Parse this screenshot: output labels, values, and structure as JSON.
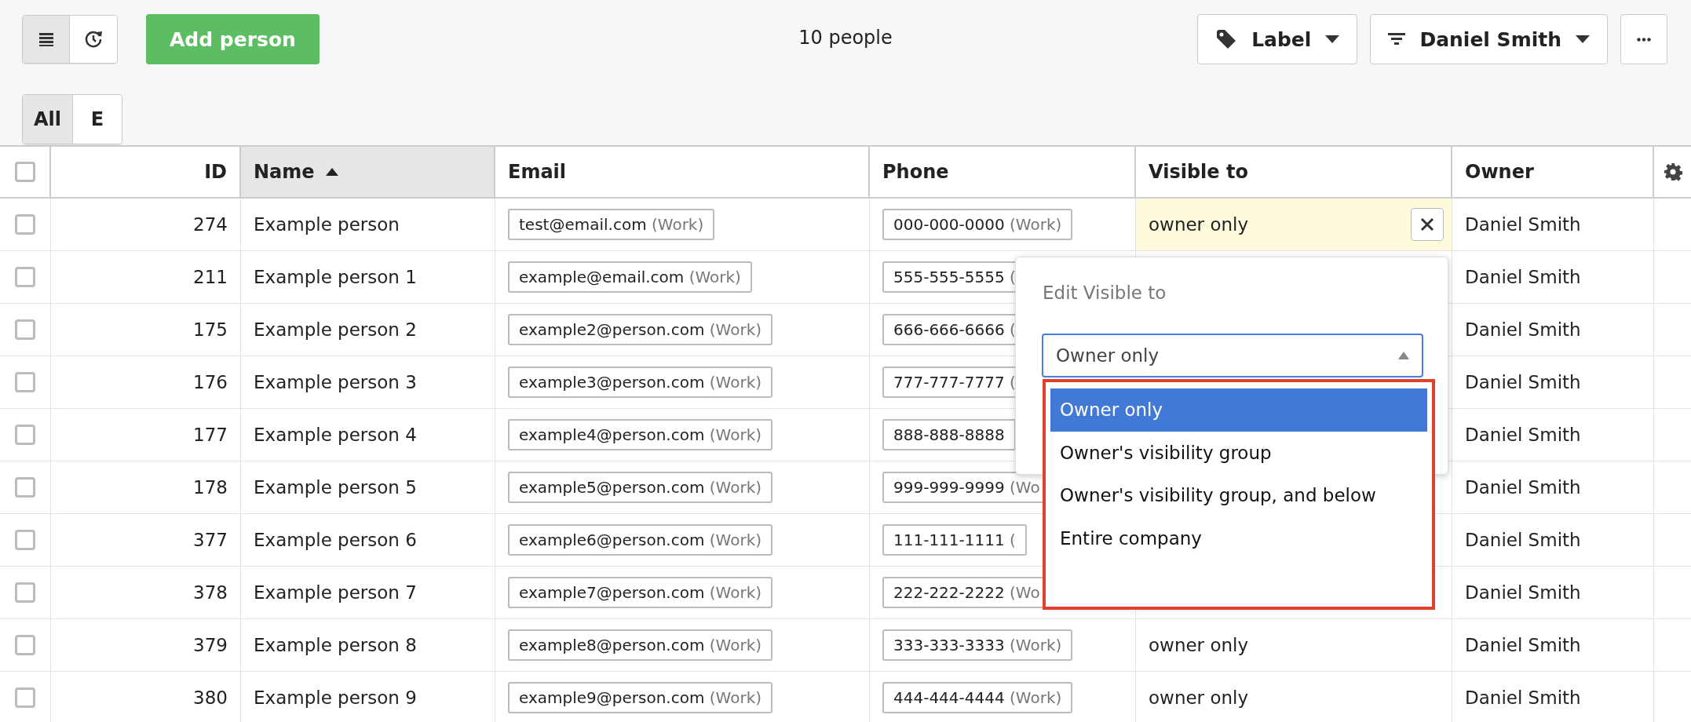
{
  "toolbar": {
    "view_toggle": [
      {
        "kind": "list",
        "selected": true
      },
      {
        "kind": "timeline",
        "selected": false
      }
    ],
    "add_button": "Add person",
    "count": "10 people",
    "label_button": "Label",
    "filter_button": "Daniel Smith",
    "segments": [
      {
        "label": "All",
        "selected": true
      },
      {
        "label": "E",
        "selected": false
      }
    ]
  },
  "table": {
    "select_all_checked": false,
    "columns": [
      {
        "label": "ID",
        "sorted": false
      },
      {
        "label": "Name",
        "sorted": true
      },
      {
        "label": "Email",
        "sorted": false
      },
      {
        "label": "Phone",
        "sorted": false
      },
      {
        "label": "Visible to",
        "sorted": false
      },
      {
        "label": "Owner",
        "sorted": false
      }
    ],
    "rows": [
      {
        "checked": false,
        "id": "274",
        "name": "Example person",
        "email": "test@email.com",
        "email_type": "(Work)",
        "phone": "000-000-0000",
        "phone_type": "(Work)",
        "visible_to": "owner only",
        "editing": true,
        "owner": "Daniel Smith"
      },
      {
        "checked": false,
        "id": "211",
        "name": "Example person 1",
        "email": "example@email.com",
        "email_type": "(Work)",
        "phone": "555-555-5555",
        "phone_type": "(",
        "editing": false,
        "owner": "Daniel Smith"
      },
      {
        "checked": false,
        "id": "175",
        "name": "Example person 2",
        "email": "example2@person.com",
        "email_type": "(Work)",
        "phone": "666-666-6666",
        "phone_type": "(",
        "editing": false,
        "owner": "Daniel Smith"
      },
      {
        "checked": false,
        "id": "176",
        "name": "Example person 3",
        "email": "example3@person.com",
        "email_type": "(Work)",
        "phone": "777-777-7777",
        "phone_type": "(",
        "editing": false,
        "owner": "Daniel Smith"
      },
      {
        "checked": false,
        "id": "177",
        "name": "Example person 4",
        "email": "example4@person.com",
        "email_type": "(Work)",
        "phone": "888-888-8888",
        "editing": false,
        "owner": "Daniel Smith"
      },
      {
        "checked": false,
        "id": "178",
        "name": "Example person 5",
        "email": "example5@person.com",
        "email_type": "(Work)",
        "phone": "999-999-9999",
        "phone_type": "(Wo",
        "editing": false,
        "owner": "Daniel Smith"
      },
      {
        "checked": false,
        "id": "377",
        "name": "Example person 6",
        "email": "example6@person.com",
        "email_type": "(Work)",
        "phone": "111-111-1111",
        "phone_type": "(",
        "editing": false,
        "owner": "Daniel Smith"
      },
      {
        "checked": false,
        "id": "378",
        "name": "Example person 7",
        "email": "example7@person.com",
        "email_type": "(Work)",
        "phone": "222-222-2222",
        "phone_type": "(Wo",
        "editing": false,
        "owner": "Daniel Smith"
      },
      {
        "checked": false,
        "id": "379",
        "name": "Example person 8",
        "email": "example8@person.com",
        "email_type": "(Work)",
        "phone": "333-333-3333",
        "phone_type": "(Work)",
        "visible_to": "owner only",
        "editing": false,
        "owner": "Daniel Smith"
      },
      {
        "checked": false,
        "id": "380",
        "name": "Example person 9",
        "email": "example9@person.com",
        "email_type": "(Work)",
        "phone": "444-444-4444",
        "phone_type": "(Work)",
        "visible_to": "owner only",
        "editing": false,
        "owner": "Daniel Smith"
      }
    ]
  },
  "popup": {
    "title": "Edit Visible to",
    "select_value": "Owner only",
    "options": [
      {
        "label": "Owner only",
        "selected": true
      },
      {
        "label": "Owner's visibility group",
        "selected": false
      },
      {
        "label": "Owner's visibility group, and below",
        "selected": false
      },
      {
        "label": "Entire company",
        "selected": false
      }
    ]
  }
}
